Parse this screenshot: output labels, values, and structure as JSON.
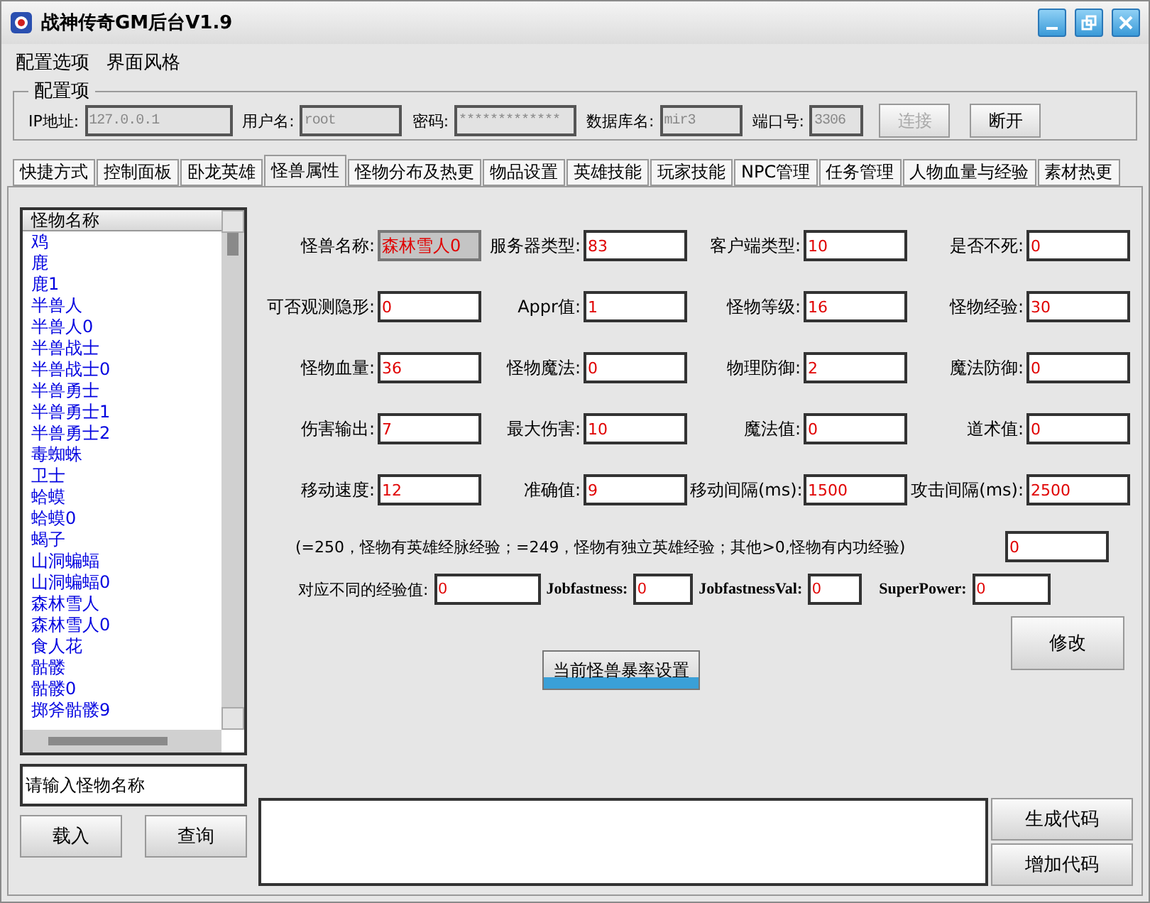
{
  "window": {
    "title": "战神传奇GM后台V1.9"
  },
  "menu": [
    "配置选项",
    "界面风格"
  ],
  "config": {
    "title": "配置项",
    "fields": [
      {
        "label": "IP地址:",
        "value": "127.0.0.1",
        "disabled": true
      },
      {
        "label": "用户名:",
        "value": "root",
        "disabled": true
      },
      {
        "label": "密码:",
        "value": "*************",
        "disabled": true
      },
      {
        "label": "数据库名:",
        "value": "mir3",
        "disabled": true
      },
      {
        "label": "端口号:",
        "value": "3306",
        "disabled": true
      }
    ],
    "buttons": [
      {
        "label": "连接",
        "disabled": true
      },
      {
        "label": "断开",
        "disabled": false
      }
    ]
  },
  "tabs": [
    {
      "label": "快捷方式",
      "selected": false
    },
    {
      "label": "控制面板",
      "selected": false
    },
    {
      "label": "卧龙英雄",
      "selected": false
    },
    {
      "label": "怪兽属性",
      "selected": true
    },
    {
      "label": "怪物分布及热更",
      "selected": false
    },
    {
      "label": "物品设置",
      "selected": false
    },
    {
      "label": "英雄技能",
      "selected": false
    },
    {
      "label": "玩家技能",
      "selected": false
    },
    {
      "label": "NPC管理",
      "selected": false
    },
    {
      "label": "任务管理",
      "selected": false
    },
    {
      "label": "人物血量与经验",
      "selected": false
    },
    {
      "label": "素材热更",
      "selected": false
    }
  ],
  "monster_list": {
    "header": "怪物名称",
    "items": [
      "鸡",
      "鹿",
      "鹿1",
      "半兽人",
      "半兽人0",
      "半兽战士",
      "半兽战士0",
      "半兽勇士",
      "半兽勇士1",
      "半兽勇士2",
      "毒蜘蛛",
      "卫士",
      "蛤蟆",
      "蛤蟆0",
      "蝎子",
      "山洞蝙蝠",
      "山洞蝙蝠0",
      "森林雪人",
      "森林雪人0",
      "食人花",
      "骷髅",
      "骷髅0",
      "掷斧骷髅9"
    ],
    "search": {
      "placeholder": "请输入怪物名称"
    },
    "buttons": [
      "载入",
      "查询"
    ]
  },
  "fields": [
    {
      "label": "怪兽名称:",
      "value": "森林雪人0",
      "disabled": true
    },
    {
      "label": "服务器类型:",
      "value": "83",
      "disabled": false
    },
    {
      "label": "客户端类型:",
      "value": "10",
      "disabled": false
    },
    {
      "label": "是否不死:",
      "value": "0",
      "disabled": false
    },
    {
      "label": "可否观测隐形:",
      "value": "0",
      "disabled": false
    },
    {
      "label": "Appr值:",
      "value": "1",
      "disabled": false
    },
    {
      "label": "怪物等级:",
      "value": "16",
      "disabled": false
    },
    {
      "label": "怪物经验:",
      "value": "30",
      "disabled": false
    },
    {
      "label": "怪物血量:",
      "value": "36",
      "disabled": false
    },
    {
      "label": "怪物魔法:",
      "value": "0",
      "disabled": false
    },
    {
      "label": "物理防御:",
      "value": "2",
      "disabled": false
    },
    {
      "label": "魔法防御:",
      "value": "0",
      "disabled": false
    },
    {
      "label": "伤害输出:",
      "value": "7",
      "disabled": false
    },
    {
      "label": "最大伤害:",
      "value": "10",
      "disabled": false
    },
    {
      "label": "魔法值:",
      "value": "0",
      "disabled": false
    },
    {
      "label": "道术值:",
      "value": "0",
      "disabled": false
    },
    {
      "label": "移动速度:",
      "value": "12",
      "disabled": false
    },
    {
      "label": "准确值:",
      "value": "9",
      "disabled": false
    },
    {
      "label": "移动间隔(ms):",
      "value": "1500",
      "disabled": false
    },
    {
      "label": "攻击间隔(ms):",
      "value": "2500",
      "disabled": false
    }
  ],
  "note": {
    "text": "(=250，怪物有英雄经脉经验；=249，怪物有独立英雄经验；其他>0,怪物有内功经验)",
    "value": "0"
  },
  "extra_fields": [
    {
      "label": "对应不同的经验值:",
      "value": "0"
    },
    {
      "label": "Jobfastness:",
      "value": "0"
    },
    {
      "label": "JobfastnessVal:",
      "value": "0"
    },
    {
      "label": "SuperPower:",
      "value": "0"
    }
  ],
  "modify_button": "修改",
  "drop_rate_button": "当前怪兽暴率设置",
  "code_buttons": [
    "生成代码",
    "增加代码"
  ]
}
